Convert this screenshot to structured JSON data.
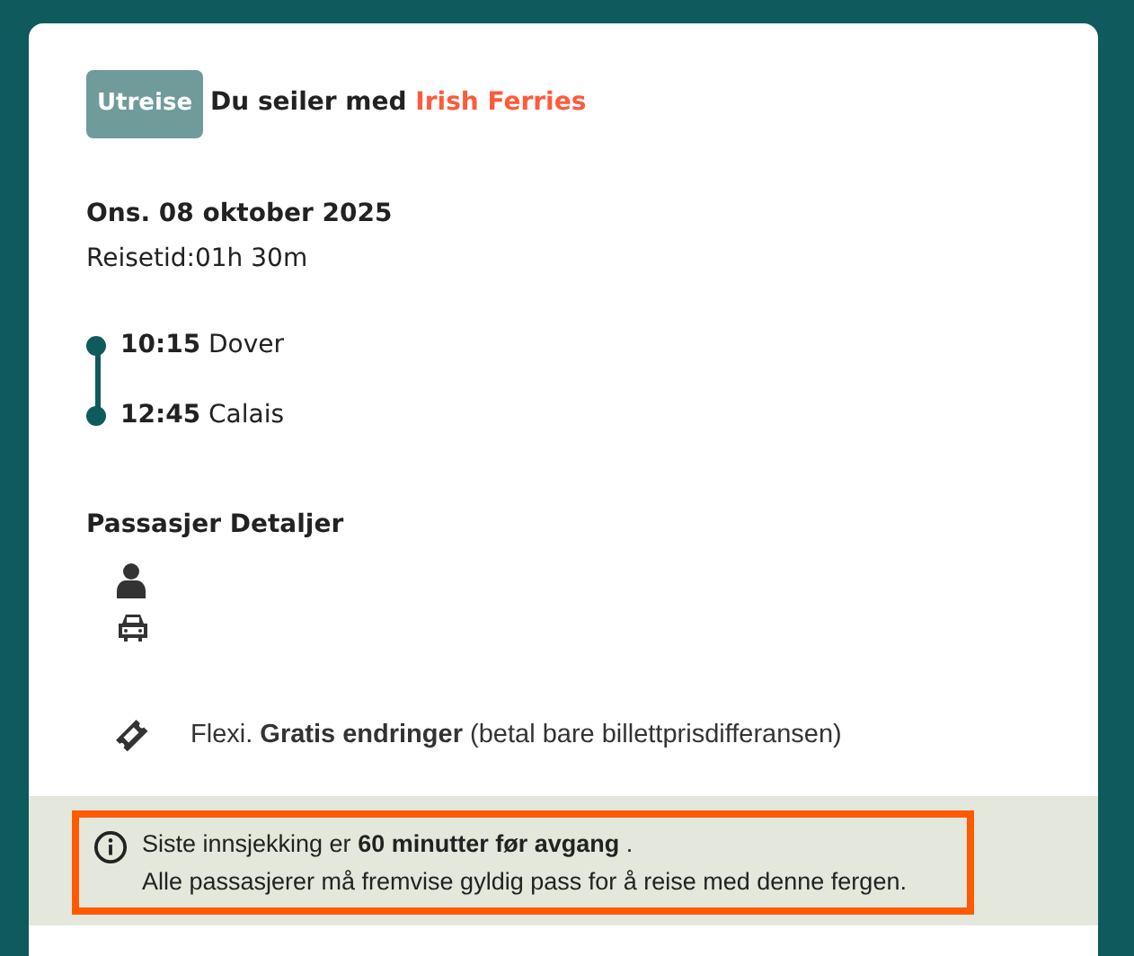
{
  "header": {
    "badge": "Utreise",
    "title": "Du seiler med",
    "operator": "Irish Ferries"
  },
  "date": "Ons. 08 oktober 2025",
  "duration": "Reisetid:01h 30m",
  "stops": [
    {
      "time": "10:15",
      "place": "Dover"
    },
    {
      "time": "12:45",
      "place": "Calais"
    }
  ],
  "passengers": {
    "title": "Passasjer Detaljer",
    "items": [
      {
        "kind": "person"
      },
      {
        "kind": "car"
      }
    ]
  },
  "fare": "Flexi. **Gratis endringer** (betal bare billettprisdifferansen)",
  "notice": {
    "lines": [
      "Siste innsjekking er **60 minutter før avgang** .",
      "Alle passasjerer må fremvise gyldig pass for å reise med denne fergen."
    ]
  }
}
